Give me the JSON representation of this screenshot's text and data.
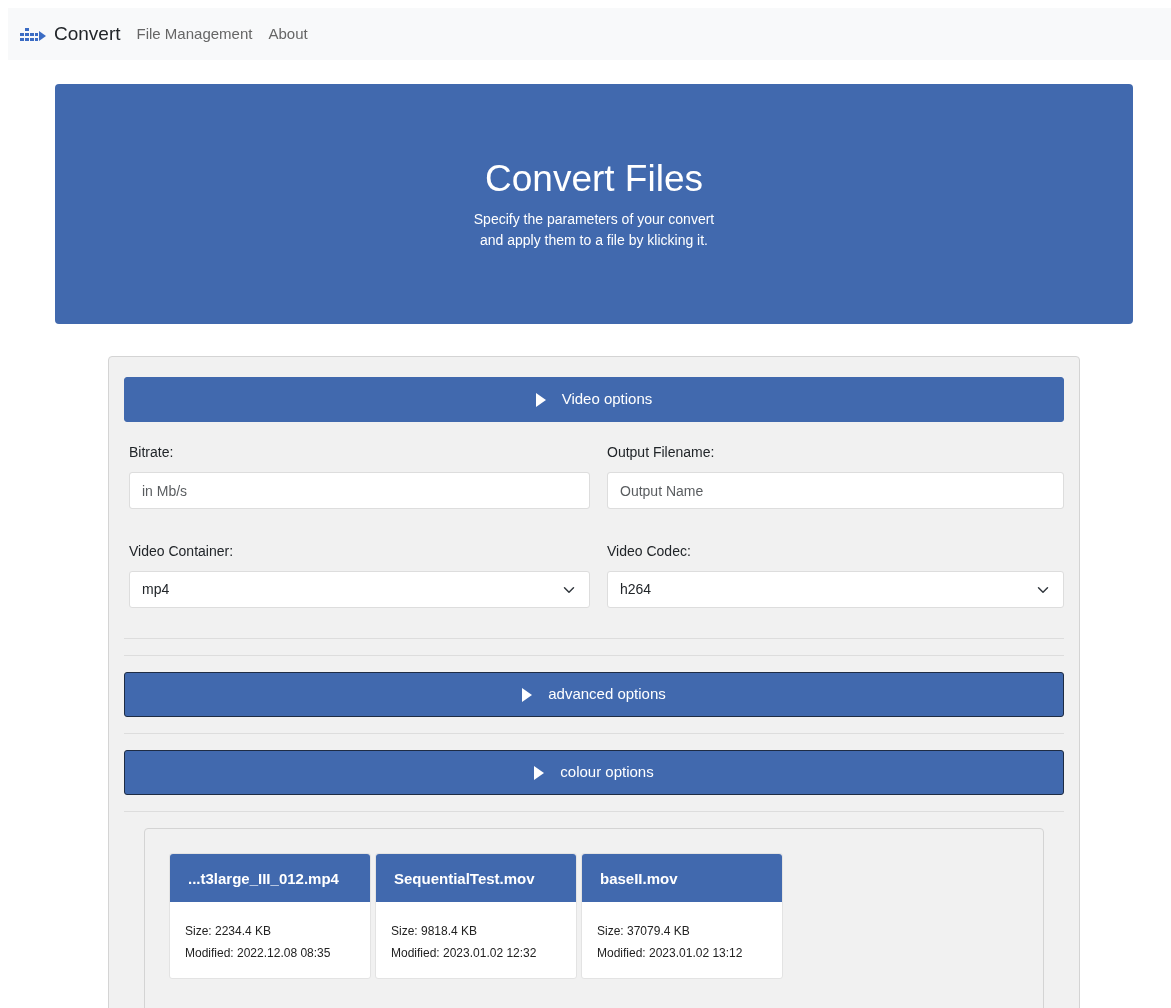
{
  "navbar": {
    "brand": "Convert",
    "links": [
      {
        "label": "File Management"
      },
      {
        "label": "About"
      }
    ]
  },
  "hero": {
    "title": "Convert Files",
    "subtitle": [
      "Specify the parameters of your convert",
      "and apply them to a file by klicking it."
    ]
  },
  "sections": [
    {
      "title": "Video options",
      "expanded": true,
      "fields": [
        {
          "kind": "input",
          "label": "Bitrate:",
          "placeholder": "in Mb/s"
        },
        {
          "kind": "input",
          "label": "Output Filename:",
          "placeholder": "Output Name"
        },
        {
          "kind": "select",
          "label": "Video Container:",
          "value": "mp4"
        },
        {
          "kind": "select",
          "label": "Video Codec:",
          "value": "h264"
        }
      ]
    },
    {
      "title": "advanced options",
      "expanded": false
    },
    {
      "title": "colour options",
      "expanded": false
    }
  ],
  "files": [
    {
      "name": "...t3large_III_012.mp4",
      "size": "Size: 2234.4 KB",
      "modified": "Modified: 2022.12.08 08:35"
    },
    {
      "name": "SequentialTest.mov",
      "size": "Size: 9818.4 KB",
      "modified": "Modified: 2023.01.02 12:32"
    },
    {
      "name": "baseII.mov",
      "size": "Size: 37079.4 KB",
      "modified": "Modified: 2023.01.02 13:12"
    }
  ]
}
